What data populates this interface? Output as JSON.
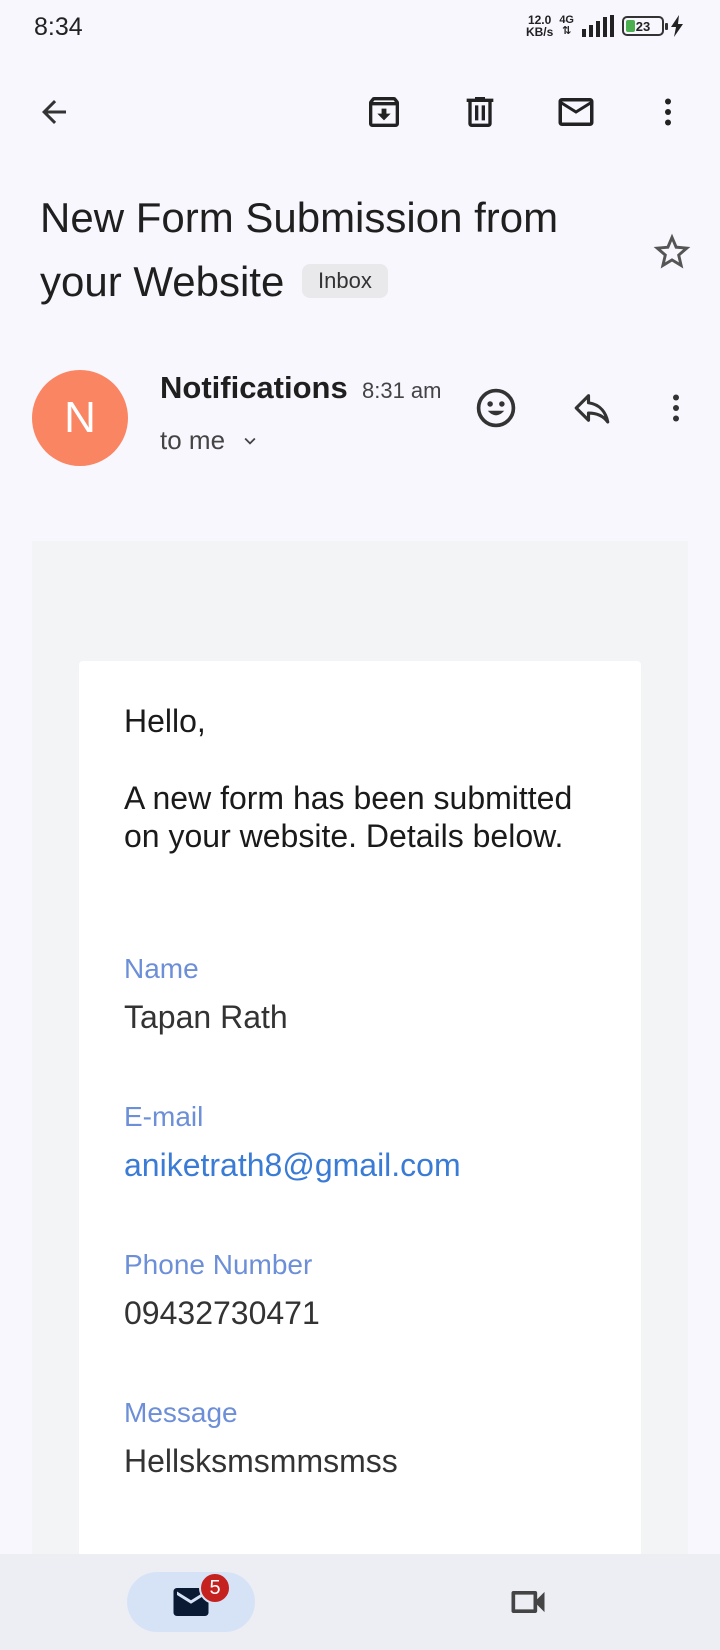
{
  "status_bar": {
    "time": "8:34",
    "net_speed_value": "12.0",
    "net_speed_unit": "KB/s",
    "network_type": "4G",
    "battery": "23"
  },
  "email": {
    "subject": "New Form Submission from your Website",
    "label_chip": "Inbox",
    "sender": "Notifications",
    "time": "8:31 am",
    "recipient": "to me",
    "avatar_letter": "N",
    "body": {
      "greeting": "Hello,",
      "intro": "A new form has been submitted on your website. Details below.",
      "fields": [
        {
          "label": "Name",
          "value": "Tapan Rath"
        },
        {
          "label": "E-mail",
          "value": "aniketrath8@gmail.com"
        },
        {
          "label": "Phone Number",
          "value": "09432730471"
        },
        {
          "label": "Message",
          "value": "Hellsksmsmmsmss"
        }
      ]
    }
  },
  "bottom_nav": {
    "mail_badge": "5"
  },
  "colors": {
    "avatar": "#fa8562",
    "field_label": "#6d8fd8",
    "link": "#3a7bd5",
    "badge": "#c5221f"
  }
}
